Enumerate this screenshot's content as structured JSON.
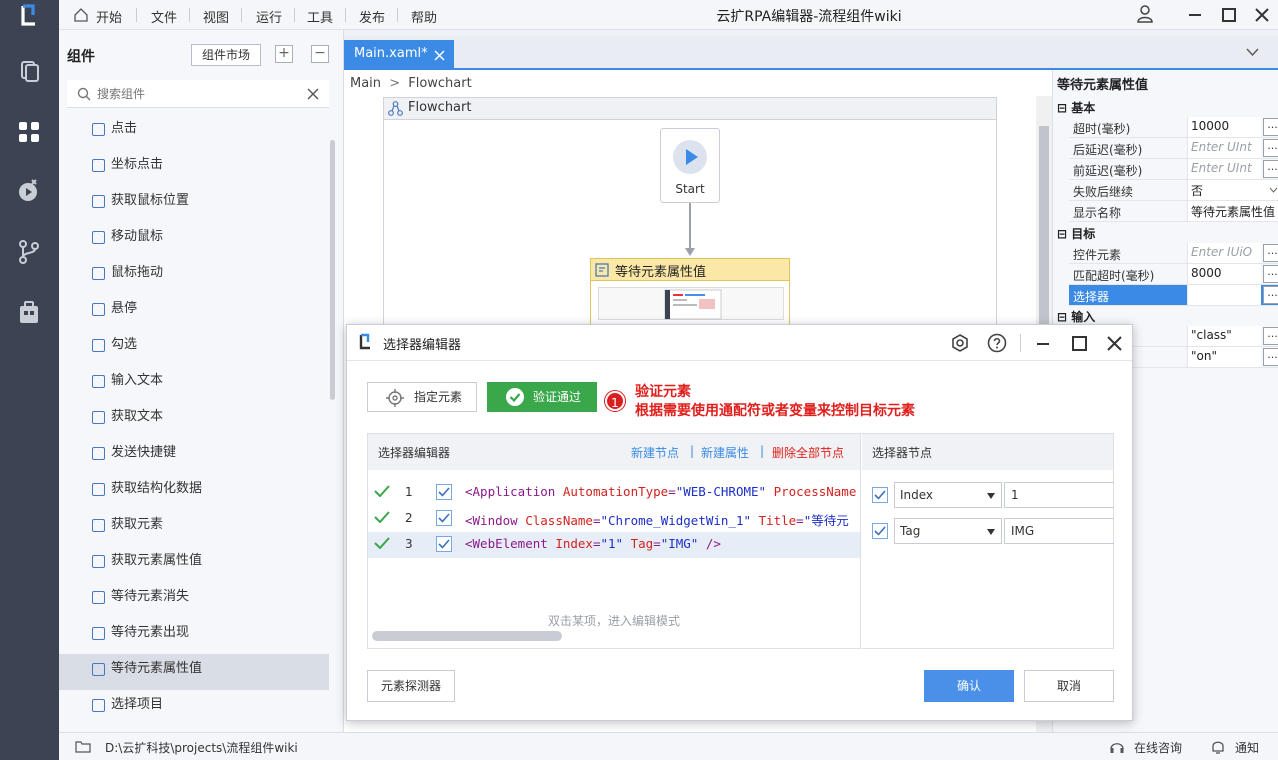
{
  "menu": {
    "home": "开始",
    "file": "文件",
    "view": "视图",
    "run": "运行",
    "tools": "工具",
    "publish": "发布",
    "help": "帮助"
  },
  "window_title": "云扩RPA编辑器-流程组件wiki",
  "components_panel": {
    "title": "组件",
    "market_button": "组件市场",
    "search_placeholder": "搜索组件",
    "items": [
      {
        "label": "点击",
        "icon": "click-icon"
      },
      {
        "label": "坐标点击",
        "icon": "coordinate-click-icon"
      },
      {
        "label": "获取鼠标位置",
        "icon": "mouse-position-icon"
      },
      {
        "label": "移动鼠标",
        "icon": "move-mouse-icon"
      },
      {
        "label": "鼠标拖动",
        "icon": "drag-mouse-icon"
      },
      {
        "label": "悬停",
        "icon": "hover-icon"
      },
      {
        "label": "勾选",
        "icon": "check-icon"
      },
      {
        "label": "输入文本",
        "icon": "type-text-icon"
      },
      {
        "label": "获取文本",
        "icon": "get-text-icon"
      },
      {
        "label": "发送快捷键",
        "icon": "hotkey-icon"
      },
      {
        "label": "获取结构化数据",
        "icon": "structured-data-icon"
      },
      {
        "label": "获取元素",
        "icon": "get-element-icon"
      },
      {
        "label": "获取元素属性值",
        "icon": "element-attribute-icon"
      },
      {
        "label": "等待元素消失",
        "icon": "wait-vanish-icon"
      },
      {
        "label": "等待元素出现",
        "icon": "wait-appear-icon"
      },
      {
        "label": "等待元素属性值",
        "icon": "wait-attribute-icon"
      },
      {
        "label": "选择项目",
        "icon": "select-item-icon"
      }
    ],
    "active_index": 15
  },
  "editor": {
    "tab_label": "Main.xaml*",
    "breadcrumb_main": "Main",
    "breadcrumb_sep": ">",
    "breadcrumb_flow": "Flowchart",
    "flowchart_title": "Flowchart",
    "start_label": "Start",
    "node_title": "等待元素属性值"
  },
  "properties": {
    "title": "等待元素属性值",
    "section_basic": "基本",
    "section_target": "目标",
    "section_input": "输入",
    "rows": {
      "timeout_key": "超时(毫秒)",
      "timeout_val": "10000",
      "after_delay_key": "后延迟(毫秒)",
      "after_delay_val": "Enter UInt",
      "before_delay_key": "前延迟(毫秒)",
      "before_delay_val": "Enter UInt",
      "continue_key": "失败后继续",
      "continue_val": "否",
      "display_key": "显示名称",
      "display_val": "等待元素属性值",
      "control_key": "控件元素",
      "control_val": "Enter IUiO",
      "match_timeout_key": "匹配超时(毫秒)",
      "match_timeout_val": "8000",
      "selector_key": "选择器",
      "selector_val": "",
      "input1_val": "\"class\"",
      "input2_val": "\"on\""
    }
  },
  "statusbar": {
    "path": "D:\\云扩科技\\projects\\流程组件wiki",
    "consult": "在线咨询",
    "notify": "通知"
  },
  "dialog": {
    "title": "选择器编辑器",
    "target_button": "指定元素",
    "verify_button": "验证通过",
    "note_number": "1",
    "note_line1": "验证元素",
    "note_line2": "根据需要使用通配符或者变量来控制目标元素",
    "editor_title": "选择器编辑器",
    "new_node": "新建节点",
    "new_attr": "新建属性",
    "delete_all": "删除全部节点",
    "link_sep": "|",
    "hint": "双击某项，进入编辑模式",
    "lines": [
      {
        "n": "1",
        "parts": [
          [
            "tag",
            "<Application "
          ],
          [
            "attr",
            "AutomationType"
          ],
          [
            "tag",
            "="
          ],
          [
            "val",
            "\"WEB-CHROME\""
          ],
          [
            "tag",
            " "
          ],
          [
            "attr",
            "ProcessName"
          ]
        ]
      },
      {
        "n": "2",
        "parts": [
          [
            "tag",
            "<Window "
          ],
          [
            "attr",
            "ClassName"
          ],
          [
            "tag",
            "="
          ],
          [
            "val",
            "\"Chrome_WidgetWin_1\""
          ],
          [
            "tag",
            " "
          ],
          [
            "attr",
            "Title"
          ],
          [
            "tag",
            "="
          ],
          [
            "val",
            "\"等待元"
          ]
        ]
      },
      {
        "n": "3",
        "parts": [
          [
            "tag",
            "<WebElement "
          ],
          [
            "attr",
            "Index"
          ],
          [
            "tag",
            "="
          ],
          [
            "val",
            "\"1\""
          ],
          [
            "tag",
            " "
          ],
          [
            "attr",
            "Tag"
          ],
          [
            "tag",
            "="
          ],
          [
            "val",
            "\"IMG\""
          ],
          [
            "tag",
            " />"
          ]
        ]
      }
    ],
    "node_title": "选择器节点",
    "nodes": [
      {
        "key": "Index",
        "value": "1"
      },
      {
        "key": "Tag",
        "value": "IMG"
      }
    ],
    "detector_button": "元素探测器",
    "confirm_button": "确认",
    "cancel_button": "取消"
  },
  "colors": {
    "accent": "#3b8be6",
    "verify_green": "#3aa74b",
    "note_red": "#e0201d",
    "sidebar_dark": "#3c4453"
  }
}
